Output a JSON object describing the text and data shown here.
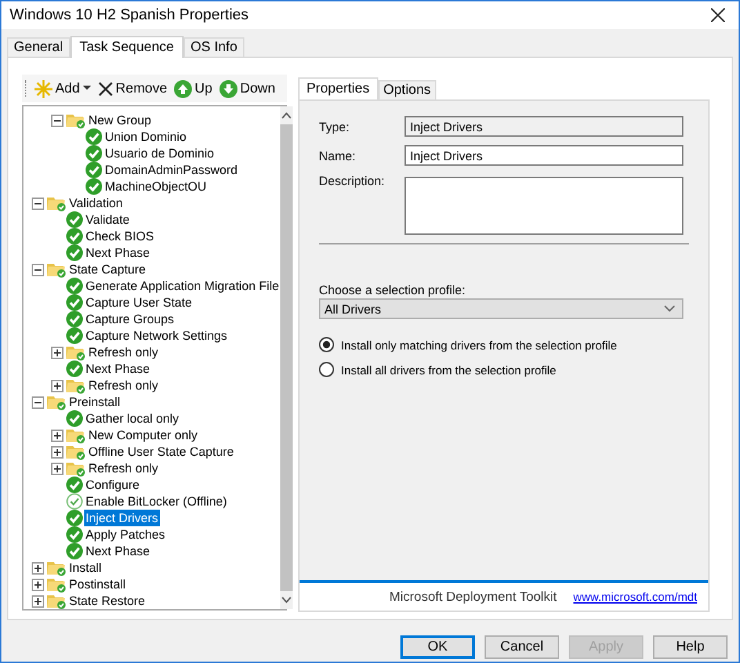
{
  "window": {
    "title": "Windows 10 H2 Spanish Properties"
  },
  "tabs": [
    {
      "label": "General",
      "selected": false
    },
    {
      "label": "Task Sequence",
      "selected": true
    },
    {
      "label": "OS Info",
      "selected": false
    }
  ],
  "toolbar": [
    {
      "kind": "add",
      "label": "Add"
    },
    {
      "kind": "remove",
      "label": "Remove"
    },
    {
      "kind": "up",
      "label": "Up"
    },
    {
      "kind": "down",
      "label": "Down"
    }
  ],
  "tree": {
    "nodes": [
      {
        "kind": "offscreen",
        "children": [
          {
            "kind": "group",
            "label": "New Group",
            "expanded": true,
            "selected": false,
            "children": [
              {
                "kind": "step",
                "label": "Union Dominio",
                "disabled": false,
                "selected": false
              },
              {
                "kind": "step",
                "label": "Usuario de Dominio",
                "disabled": false,
                "selected": false
              },
              {
                "kind": "step",
                "label": "DomainAdminPassword",
                "disabled": false,
                "selected": false
              },
              {
                "kind": "step",
                "label": "MachineObjectOU",
                "disabled": false,
                "selected": false
              }
            ]
          }
        ]
      },
      {
        "kind": "group",
        "label": "Validation",
        "expanded": true,
        "selected": false,
        "children": [
          {
            "kind": "step",
            "label": "Validate",
            "disabled": false,
            "selected": false
          },
          {
            "kind": "step",
            "label": "Check BIOS",
            "disabled": false,
            "selected": false
          },
          {
            "kind": "step",
            "label": "Next Phase",
            "disabled": false,
            "selected": false
          }
        ]
      },
      {
        "kind": "group",
        "label": "State Capture",
        "expanded": true,
        "selected": false,
        "children": [
          {
            "kind": "step",
            "label": "Generate Application Migration File",
            "disabled": false,
            "selected": false
          },
          {
            "kind": "step",
            "label": "Capture User State",
            "disabled": false,
            "selected": false
          },
          {
            "kind": "step",
            "label": "Capture Groups",
            "disabled": false,
            "selected": false
          },
          {
            "kind": "step",
            "label": "Capture Network Settings",
            "disabled": false,
            "selected": false
          },
          {
            "kind": "group",
            "label": "Refresh only",
            "expanded": false,
            "selected": false
          },
          {
            "kind": "step",
            "label": "Next Phase",
            "disabled": false,
            "selected": false
          },
          {
            "kind": "group",
            "label": "Refresh only",
            "expanded": false,
            "selected": false
          }
        ]
      },
      {
        "kind": "group",
        "label": "Preinstall",
        "expanded": true,
        "selected": false,
        "children": [
          {
            "kind": "step",
            "label": "Gather local only",
            "disabled": false,
            "selected": false
          },
          {
            "kind": "group",
            "label": "New Computer only",
            "expanded": false,
            "selected": false
          },
          {
            "kind": "group",
            "label": "Offline User State Capture",
            "expanded": false,
            "selected": false
          },
          {
            "kind": "group",
            "label": "Refresh only",
            "expanded": false,
            "selected": false
          },
          {
            "kind": "step",
            "label": "Configure",
            "disabled": false,
            "selected": false
          },
          {
            "kind": "step",
            "label": "Enable BitLocker (Offline)",
            "disabled": true,
            "selected": false
          },
          {
            "kind": "step",
            "label": "Inject Drivers",
            "disabled": false,
            "selected": true
          },
          {
            "kind": "step",
            "label": "Apply Patches",
            "disabled": false,
            "selected": false
          },
          {
            "kind": "step",
            "label": "Next Phase",
            "disabled": false,
            "selected": false
          }
        ]
      },
      {
        "kind": "group",
        "label": "Install",
        "expanded": false,
        "selected": false
      },
      {
        "kind": "group",
        "label": "Postinstall",
        "expanded": false,
        "selected": false
      },
      {
        "kind": "group",
        "label": "State Restore",
        "expanded": false,
        "selected": false
      }
    ]
  },
  "detail_tabs": [
    {
      "label": "Properties",
      "selected": true
    },
    {
      "label": "Options",
      "selected": false
    }
  ],
  "properties": {
    "type_label": "Type:",
    "type_value": "Inject Drivers",
    "name_label": "Name:",
    "name_value": "Inject Drivers",
    "description_label": "Description:",
    "profile_label": "Choose a selection profile:",
    "profile_value": "All Drivers",
    "options": [
      {
        "label": "Install only matching drivers from the selection profile",
        "selected": true
      },
      {
        "label": "Install all drivers from the selection profile",
        "selected": false
      }
    ]
  },
  "footer": {
    "product": "Microsoft Deployment Toolkit",
    "link": "www.microsoft.com/mdt"
  },
  "buttons": [
    {
      "label": "OK",
      "disabled": false,
      "default": true
    },
    {
      "label": "Cancel",
      "disabled": false,
      "default": false
    },
    {
      "label": "Apply",
      "disabled": true,
      "default": false
    },
    {
      "label": "Help",
      "disabled": false,
      "default": false
    }
  ]
}
